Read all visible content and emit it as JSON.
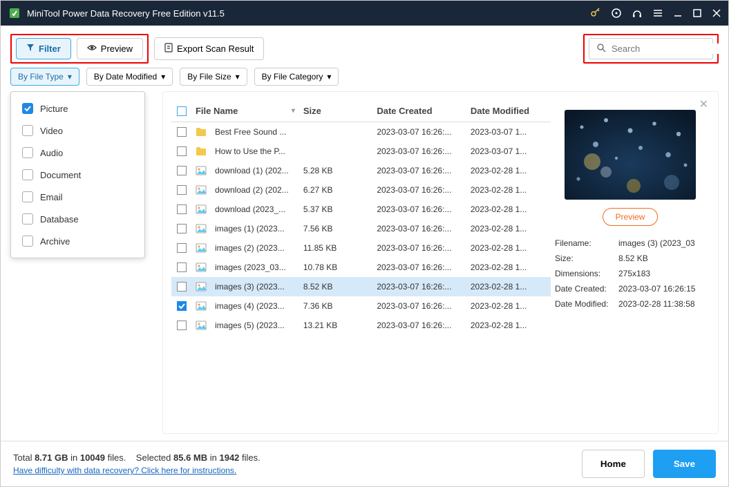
{
  "titlebar": {
    "title": "MiniTool Power Data Recovery Free Edition v11.5"
  },
  "toolbar": {
    "filter_label": "Filter",
    "preview_label": "Preview",
    "export_label": "Export Scan Result"
  },
  "search": {
    "placeholder": "Search"
  },
  "filters": {
    "by_file_type": "By File Type",
    "by_date_modified": "By Date Modified",
    "by_file_size": "By File Size",
    "by_file_category": "By File Category"
  },
  "file_type_options": [
    {
      "label": "Picture",
      "checked": true
    },
    {
      "label": "Video",
      "checked": false
    },
    {
      "label": "Audio",
      "checked": false
    },
    {
      "label": "Document",
      "checked": false
    },
    {
      "label": "Email",
      "checked": false
    },
    {
      "label": "Database",
      "checked": false
    },
    {
      "label": "Archive",
      "checked": false
    }
  ],
  "table": {
    "headers": {
      "name": "File Name",
      "size": "Size",
      "created": "Date Created",
      "modified": "Date Modified"
    },
    "rows": [
      {
        "icon": "folder",
        "name": "Best Free Sound ...",
        "size": "",
        "created": "2023-03-07 16:26:...",
        "modified": "2023-03-07 1...",
        "checked": false,
        "selected": false
      },
      {
        "icon": "folder",
        "name": "How to Use the P...",
        "size": "",
        "created": "2023-03-07 16:26:...",
        "modified": "2023-03-07 1...",
        "checked": false,
        "selected": false
      },
      {
        "icon": "image",
        "name": "download (1) (202...",
        "size": "5.28 KB",
        "created": "2023-03-07 16:26:...",
        "modified": "2023-02-28 1...",
        "checked": false,
        "selected": false
      },
      {
        "icon": "image",
        "name": "download (2) (202...",
        "size": "6.27 KB",
        "created": "2023-03-07 16:26:...",
        "modified": "2023-02-28 1...",
        "checked": false,
        "selected": false
      },
      {
        "icon": "image",
        "name": "download (2023_...",
        "size": "5.37 KB",
        "created": "2023-03-07 16:26:...",
        "modified": "2023-02-28 1...",
        "checked": false,
        "selected": false
      },
      {
        "icon": "image",
        "name": "images (1) (2023...",
        "size": "7.56 KB",
        "created": "2023-03-07 16:26:...",
        "modified": "2023-02-28 1...",
        "checked": false,
        "selected": false
      },
      {
        "icon": "image",
        "name": "images (2) (2023...",
        "size": "11.85 KB",
        "created": "2023-03-07 16:26:...",
        "modified": "2023-02-28 1...",
        "checked": false,
        "selected": false
      },
      {
        "icon": "image",
        "name": "images (2023_03...",
        "size": "10.78 KB",
        "created": "2023-03-07 16:26:...",
        "modified": "2023-02-28 1...",
        "checked": false,
        "selected": false
      },
      {
        "icon": "image",
        "name": "images (3) (2023...",
        "size": "8.52 KB",
        "created": "2023-03-07 16:26:...",
        "modified": "2023-02-28 1...",
        "checked": false,
        "selected": true
      },
      {
        "icon": "image",
        "name": "images (4) (2023...",
        "size": "7.36 KB",
        "created": "2023-03-07 16:26:...",
        "modified": "2023-02-28 1...",
        "checked": true,
        "selected": false
      },
      {
        "icon": "image",
        "name": "images (5) (2023...",
        "size": "13.21 KB",
        "created": "2023-03-07 16:26:...",
        "modified": "2023-02-28 1...",
        "checked": false,
        "selected": false
      }
    ]
  },
  "preview": {
    "button_label": "Preview",
    "meta": {
      "filename_label": "Filename:",
      "filename_value": "images (3) (2023_03",
      "size_label": "Size:",
      "size_value": "8.52 KB",
      "dimensions_label": "Dimensions:",
      "dimensions_value": "275x183",
      "created_label": "Date Created:",
      "created_value": "2023-03-07 16:26:15",
      "modified_label": "Date Modified:",
      "modified_value": "2023-02-28 11:38:58"
    }
  },
  "statusbar": {
    "total_prefix": "Total ",
    "total_size": "8.71 GB",
    "total_in": " in ",
    "total_files": "10049",
    "total_suffix": " files.",
    "selected_prefix": "Selected ",
    "selected_size": "85.6 MB",
    "selected_in": " in ",
    "selected_files": "1942",
    "selected_suffix": " files.",
    "help_link": "Have difficulty with data recovery? Click here for instructions.",
    "home_label": "Home",
    "save_label": "Save"
  }
}
